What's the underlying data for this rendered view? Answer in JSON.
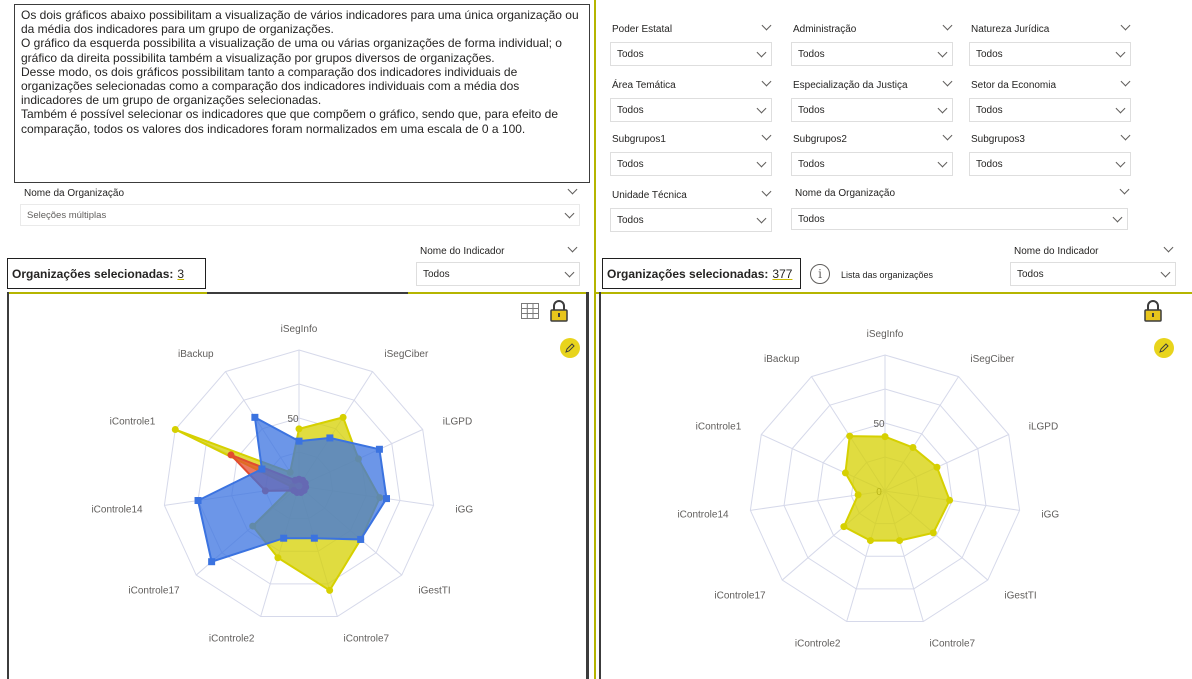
{
  "description": {
    "paragraphs": [
      "Os dois gráficos abaixo possibilitam a visualização de vários indicadores para uma única organização ou da média dos indicadores para um grupo de organizações.",
      "O gráfico da esquerda possibilita a visualização de uma ou várias organizações de forma individual; o gráfico da direita possibilita também a visualização por grupos diversos de organizações.",
      "Desse modo, os dois gráficos possibilitam tanto a comparação dos indicadores individuais de organizações selecionadas como a comparação dos indicadores individuais com a média dos indicadores de um grupo de organizações selecionadas.",
      "Também é possível selecionar os indicadores que que compõem o gráfico, sendo que, para efeito de comparação, todos os valores dos indicadores foram normalizados em uma escala de 0 a 100."
    ]
  },
  "left": {
    "org_slicer": {
      "title": "Nome da Organização",
      "value": "Seleções múltiplas"
    },
    "indicator_slicer": {
      "title": "Nome do Indicador",
      "value": "Todos"
    },
    "selected": {
      "label": "Organizações selecionadas:",
      "count": "3"
    }
  },
  "right": {
    "slicers": [
      {
        "title": "Poder Estatal",
        "value": "Todos"
      },
      {
        "title": "Administração",
        "value": "Todos"
      },
      {
        "title": "Natureza Jurídica",
        "value": "Todos"
      },
      {
        "title": "Área Temática",
        "value": "Todos"
      },
      {
        "title": "Especialização da Justiça",
        "value": "Todos"
      },
      {
        "title": "Setor da Economia",
        "value": "Todos"
      },
      {
        "title": "Subgrupos1",
        "value": "Todos"
      },
      {
        "title": "Subgrupos2",
        "value": "Todos"
      },
      {
        "title": "Subgrupos3",
        "value": "Todos"
      },
      {
        "title": "Unidade Técnica",
        "value": "Todos"
      }
    ],
    "org_slicer": {
      "title": "Nome da Organização",
      "value": "Todos"
    },
    "indicator_slicer": {
      "title": "Nome do Indicador",
      "value": "Todos"
    },
    "selected": {
      "label": "Organizações selecionadas:",
      "count": "377"
    },
    "org_list_label": "Lista das organizações"
  },
  "icons": {
    "grid": "table-grid-icon",
    "lock": "lock-icon",
    "pencil": "pencil-icon",
    "info": "info-icon",
    "chevron": "chevron-down-icon"
  },
  "colors": {
    "yellow": "#d6d000",
    "blue": "#3b73e0",
    "red": "#e24b2f",
    "accent": "#e8d41c"
  },
  "chart_data": [
    {
      "type": "radar",
      "axes": [
        "iSegInfo",
        "iSegCiber",
        "iLGPD",
        "iGG",
        "iGestTI",
        "iControle7",
        "iControle2",
        "iControle17",
        "iControle14",
        "iControle1",
        "iBackup"
      ],
      "ticks": [
        {
          "value": 0,
          "label": "0"
        },
        {
          "value": 50,
          "label": "50"
        }
      ],
      "rmax": 100,
      "series": [
        {
          "color": "#d6d000",
          "values": [
            42,
            60,
            48,
            60,
            60,
            80,
            55,
            45,
            5,
            100,
            12
          ]
        },
        {
          "color": "#e24b2f",
          "values": [
            5,
            5,
            5,
            5,
            5,
            5,
            5,
            5,
            25,
            55,
            5
          ]
        },
        {
          "color": "#3b73e0",
          "values": [
            33,
            42,
            65,
            65,
            60,
            40,
            40,
            85,
            75,
            30,
            60
          ]
        }
      ]
    },
    {
      "type": "radar",
      "axes": [
        "iSegInfo",
        "iSegCiber",
        "iLGPD",
        "iGG",
        "iGestTI",
        "iControle7",
        "iControle2",
        "iControle17",
        "iControle14",
        "iControle1",
        "iBackup"
      ],
      "ticks": [
        {
          "value": 0,
          "label": "0"
        },
        {
          "value": 50,
          "label": "50"
        }
      ],
      "rmax": 100,
      "series": [
        {
          "color": "#d6d000",
          "values": [
            40,
            38,
            42,
            48,
            47,
            38,
            38,
            40,
            20,
            32,
            48
          ]
        }
      ]
    }
  ]
}
